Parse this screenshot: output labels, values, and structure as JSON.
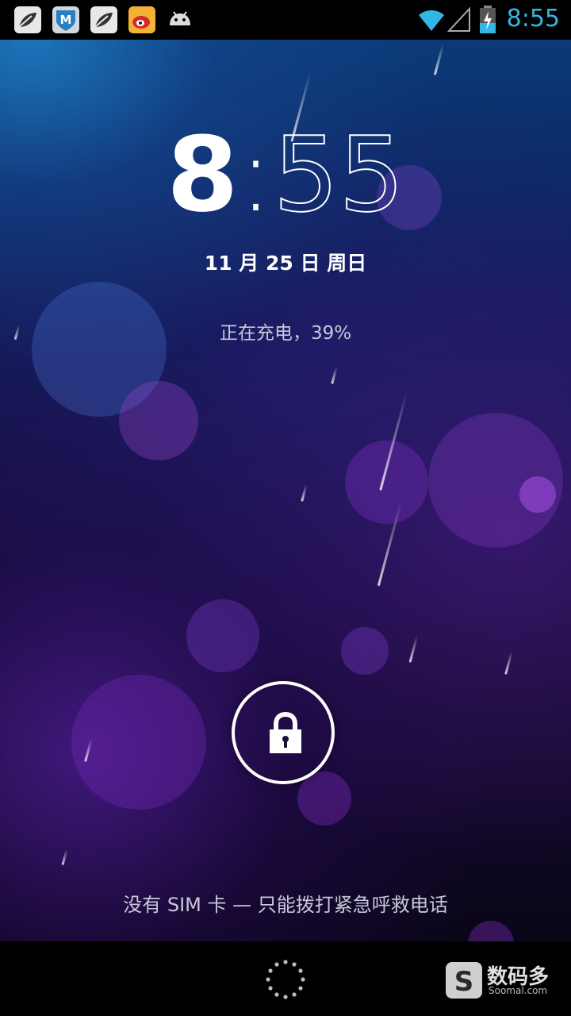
{
  "status_bar": {
    "time": "8:55",
    "notification_icons": [
      "leaf-app-icon",
      "security-m-app-icon",
      "leaf-app-icon",
      "weibo-app-icon",
      "android-icon"
    ],
    "wifi": "wifi-full-icon",
    "signal": "no-signal-icon",
    "battery": "battery-charging-icon",
    "accent_color": "#33b5e5"
  },
  "lockscreen": {
    "clock_hour": "8",
    "clock_separator": ":",
    "clock_minutes": "55",
    "date": "11 月 25 日 周日",
    "charging_status": "正在充电，39%",
    "unlock_icon": "padlock-icon",
    "carrier_message": "没有 SIM 卡 — 只能拨打紧急呼救电话"
  },
  "navbar": {
    "loading_icon": "loading-dots-icon"
  },
  "watermark": {
    "logo_letter": "S",
    "title": "数码多",
    "subtitle": "Soomal.com"
  }
}
